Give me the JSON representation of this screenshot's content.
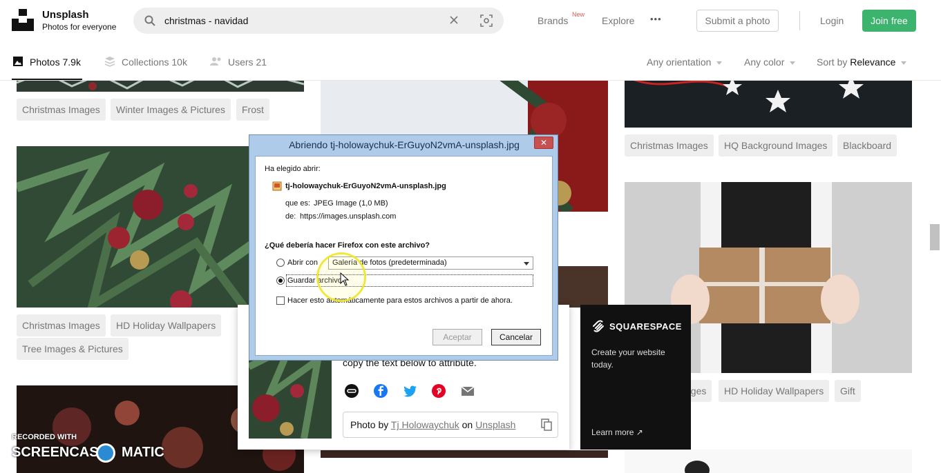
{
  "header": {
    "brand_name": "Unsplash",
    "brand_sub": "Photos for everyone",
    "search_value": "christmas - navidad",
    "nav_brands": "Brands",
    "nav_new": "New",
    "nav_explore": "Explore",
    "nav_more": "•••",
    "submit_label": "Submit a photo",
    "login_label": "Login",
    "join_label": "Join free"
  },
  "tabs": {
    "photos": "Photos 7.9k",
    "collections": "Collections 10k",
    "users": "Users 21"
  },
  "filters": {
    "orientation": "Any orientation",
    "color": "Any color",
    "sort_prefix": "Sort by ",
    "sort_value": "Relevance"
  },
  "tags": {
    "col1_a": [
      "Christmas Images",
      "Winter Images & Pictures",
      "Frost"
    ],
    "col1_b": [
      "Christmas Images",
      "HD Holiday Wallpapers",
      "Tree Images & Pictures"
    ],
    "col3_a": [
      "Christmas Images",
      "HQ Background Images",
      "Blackboard"
    ],
    "col3_b": [
      "ages",
      "HD Holiday Wallpapers",
      "Gift"
    ]
  },
  "modal": {
    "text": "copy the text below to attribute.",
    "credit_prefix": "Photo by ",
    "credit_author": "Tj Holowaychuk",
    "credit_on": " on ",
    "credit_site": "Unsplash"
  },
  "ad": {
    "logo": "SQUARESPACE",
    "text": "Create your website today.",
    "more": "Learn more ↗"
  },
  "dialog": {
    "title": "Abriendo tj-holowaychuk-ErGuyoN2vmA-unsplash.jpg",
    "close": "✕",
    "chosen_label": "Ha elegido abrir:",
    "filename": "tj-holowaychuk-ErGuyoN2vmA-unsplash.jpg",
    "type_label": "que es:",
    "type_value": "JPEG Image (1,0 MB)",
    "from_label": "de:",
    "from_value": "https://images.unsplash.com",
    "question": "¿Qué debería hacer Firefox con este archivo?",
    "open_with": "Abrir con",
    "open_with_app": "Galería de fotos (predeterminada)",
    "save_file": "Guardar archivo",
    "auto_label": "Hacer esto automáticamente para estos archivos a partir de ahora.",
    "accept": "Aceptar",
    "cancel": "Cancelar"
  },
  "watermark": {
    "line1": "RECORDED WITH",
    "left": "SCREENCAST",
    "right": "MATIC"
  },
  "colors": {
    "accent_green": "#3cb46e",
    "dialog_frame": "#aecbea"
  }
}
